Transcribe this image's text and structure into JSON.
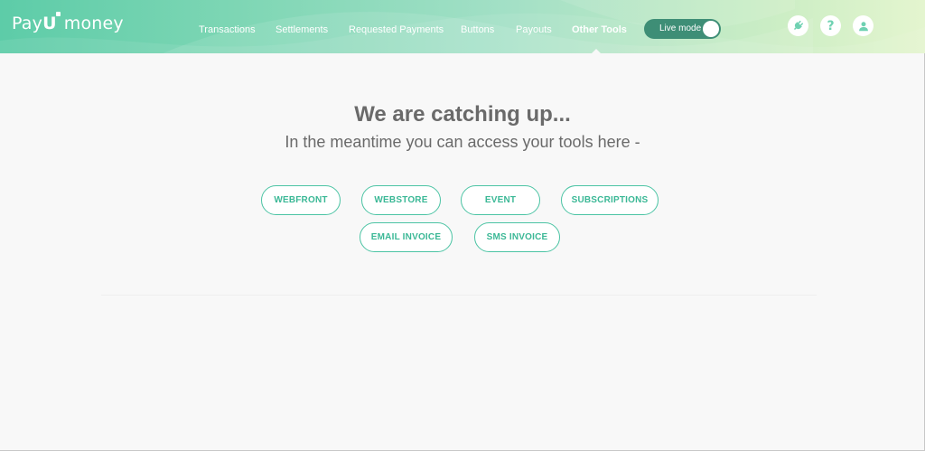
{
  "brand": {
    "logo_pay": "Pay",
    "logo_u": "U",
    "logo_money": "money"
  },
  "nav": {
    "items": [
      {
        "label": "Transactions"
      },
      {
        "label": "Settlements"
      },
      {
        "label": "Requested Payments"
      },
      {
        "label": "Buttons"
      },
      {
        "label": "Payouts"
      },
      {
        "label": "Other Tools",
        "active": true
      }
    ]
  },
  "mode_toggle": {
    "label": "Live mode",
    "state": "on"
  },
  "header_icons": [
    "plug-icon",
    "help-icon",
    "user-icon"
  ],
  "header_icon_glyphs": {
    "help": "?"
  },
  "main": {
    "title": "We are catching up...",
    "subtitle": "In the meantime you can access your tools here -",
    "tools": [
      {
        "label": "WEBFRONT"
      },
      {
        "label": "WEBSTORE"
      },
      {
        "label": "EVENT"
      },
      {
        "label": "SUBSCRIPTIONS"
      },
      {
        "label": "EMAIL INVOICE"
      },
      {
        "label": "SMS INVOICE"
      }
    ]
  },
  "colors": {
    "accent": "#4cc4a4",
    "toggle_bg": "#3e8e76",
    "heading_text": "#6a6a6a",
    "header_gradient_start": "#5dcca8",
    "header_gradient_end": "#e4f5cf"
  }
}
